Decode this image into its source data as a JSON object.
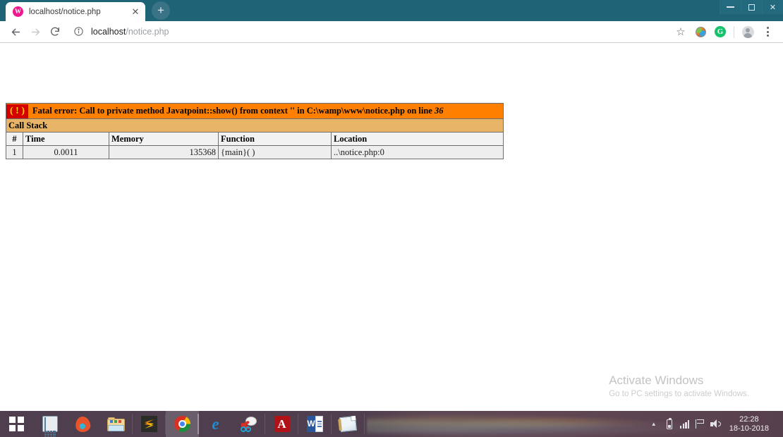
{
  "window": {
    "controls": {
      "minimize": "minimize-button",
      "restore": "restore-button",
      "close": "✕"
    }
  },
  "browser": {
    "tabs": [
      {
        "title": "localhost/notice.php",
        "favicon": "wampserver-icon",
        "favicon_letter": "W",
        "close_label": "✕",
        "active": true
      }
    ],
    "new_tab_label": "+",
    "toolbar": {
      "back_label": "back-icon",
      "forward_label": "forward-icon",
      "reload_label": "reload-icon",
      "site_info_label": "info-icon",
      "url_host": "localhost",
      "url_path": "/notice.php",
      "url_full": "localhost/notice.php",
      "bookmark_label": "☆",
      "extension_globe": "globe-extension-icon",
      "extension_grammarly": "G",
      "profile_label": "avatar-icon",
      "menu_label": "kebab-menu-icon"
    }
  },
  "page": {
    "error": {
      "badge": "( ! )",
      "prefix": "Fatal error: Call to private method Javatpoint::show() from context '' in C:\\wamp\\www\\notice.php on line ",
      "line_number": "36"
    },
    "call_stack_label": "Call Stack",
    "table": {
      "headers": [
        "#",
        "Time",
        "Memory",
        "Function",
        "Location"
      ],
      "rows": [
        {
          "num": "1",
          "time": "0.0011",
          "memory": "135368",
          "function": "{main}( )",
          "location": "..\\notice.php:0"
        }
      ]
    },
    "watermark": {
      "title": "Activate Windows",
      "subtitle": "Go to PC settings to activate Windows."
    }
  },
  "taskbar": {
    "items": [
      {
        "name": "start-button",
        "label": "Start"
      },
      {
        "name": "calculator",
        "label": "Calculator"
      },
      {
        "name": "opera-browser",
        "label": "Opera"
      },
      {
        "name": "file-explorer",
        "label": "File Explorer"
      },
      {
        "name": "sublime-text",
        "label": "Sublime Text"
      },
      {
        "name": "google-chrome",
        "label": "Google Chrome"
      },
      {
        "name": "internet-explorer",
        "label": "Internet Explorer",
        "glyph": "e"
      },
      {
        "name": "snipping-tool",
        "label": "Snipping Tool"
      },
      {
        "name": "adobe-reader",
        "label": "Adobe Acrobat Reader",
        "glyph": "A"
      },
      {
        "name": "microsoft-word",
        "label": "Microsoft Word",
        "glyph": "W"
      },
      {
        "name": "sticky-notes",
        "label": "Sticky Notes"
      }
    ],
    "tray": {
      "show_hidden_label": "▲",
      "battery_label": "battery-icon",
      "network_label": "network-icon",
      "action_center_label": "action-center-icon",
      "volume_label": "volume-icon",
      "time": "22:28",
      "date": "18-10-2018"
    }
  },
  "colors": {
    "tabstrip": "#1f6377",
    "error_bar": "#ff8000",
    "call_stack_bar": "#e8b468",
    "error_badge": "#d40000",
    "taskbar": "#483848"
  }
}
